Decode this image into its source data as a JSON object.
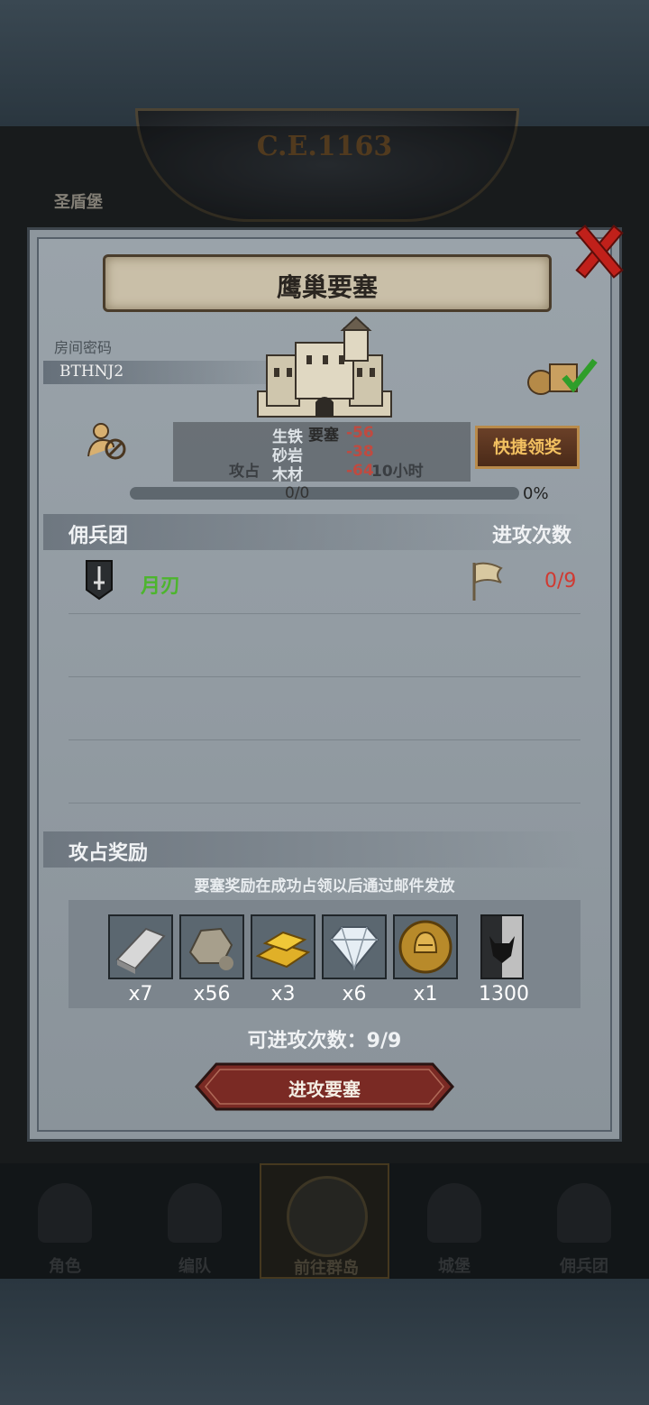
{
  "background": {
    "era": "C.E.1163",
    "city": "圣盾堡"
  },
  "nav": {
    "items": [
      {
        "label": "角色"
      },
      {
        "label": "编队"
      },
      {
        "label": "前往群岛"
      },
      {
        "label": "城堡"
      },
      {
        "label": "佣兵团"
      }
    ],
    "active_index": 2
  },
  "dialog": {
    "title": "鹰巢要塞",
    "room_label": "房间密码",
    "room_code": "BTHNJ2",
    "resources": {
      "iron": {
        "label": "生铁",
        "value": "-56"
      },
      "fortress_label": "要塞",
      "sandstone": {
        "label": "砂岩",
        "value": "-38"
      },
      "wood": {
        "label": "木材",
        "value": "-64"
      },
      "attack_hint": "攻占",
      "hours_text": "10小时"
    },
    "claim_button": "快捷领奖",
    "progress": {
      "text": "0/0",
      "percent_label": "0%",
      "fraction": 0
    },
    "mercenary_header": "佣兵团",
    "attack_count_header": "进攻次数",
    "mercenary": {
      "name": "月刃",
      "attacks": "0/9"
    },
    "reward_header": "攻占奖励",
    "reward_note": "要塞奖励在成功占领以后通过邮件发放",
    "rewards": [
      {
        "icon": "silver-ingot-icon",
        "qty": "x7"
      },
      {
        "icon": "stone-ore-icon",
        "qty": "x56"
      },
      {
        "icon": "gold-bars-icon",
        "qty": "x3"
      },
      {
        "icon": "diamond-icon",
        "qty": "x6"
      },
      {
        "icon": "helmet-medal-icon",
        "qty": "x1"
      },
      {
        "icon": "bull-banner-icon",
        "qty": "1300"
      }
    ],
    "attempts_label": "可进攻次数：9/9",
    "attack_button": "进攻要塞"
  },
  "colors": {
    "merc_name": "#4db52e",
    "attack_count": "#d03a32",
    "claim_text": "#f2c060",
    "close_x": "#c0201a"
  }
}
